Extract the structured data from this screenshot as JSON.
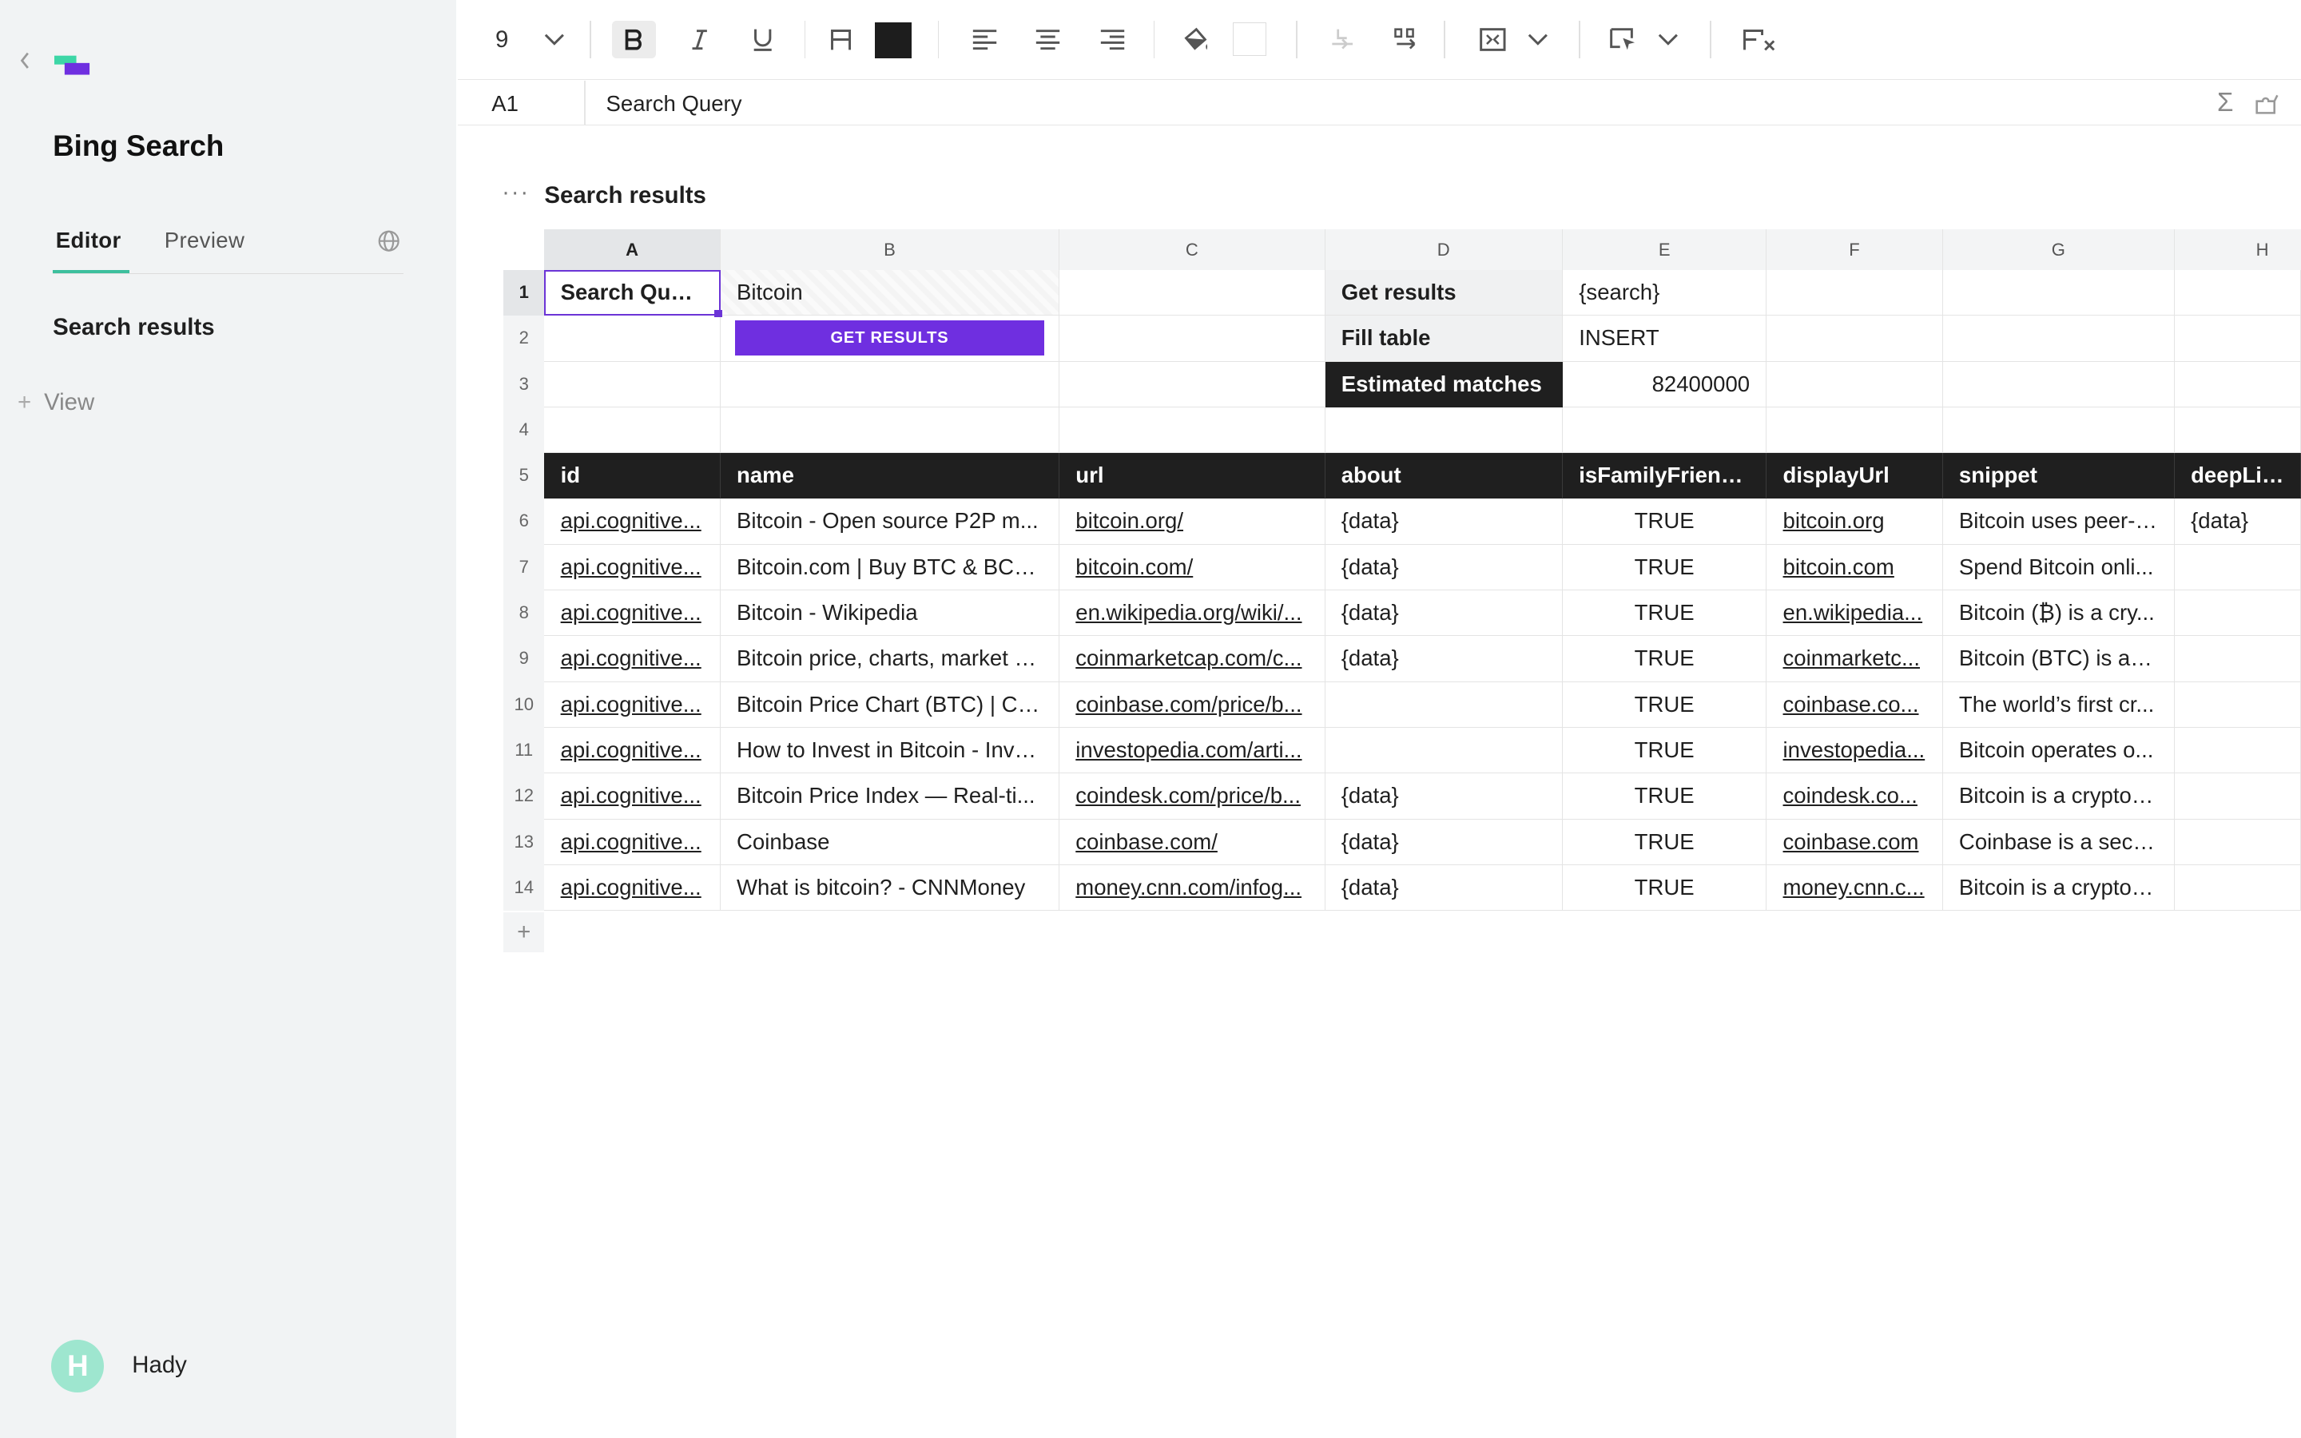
{
  "sidebar": {
    "app_title": "Bing Search",
    "tabs": [
      "Editor",
      "Preview"
    ],
    "section": "Search results",
    "add_view_label": "View",
    "user": {
      "initial": "H",
      "name": "Hady"
    }
  },
  "toolbar": {
    "font_size": "9",
    "icons": [
      "chevron-down-icon",
      "bold-icon",
      "italic-icon",
      "underline-icon",
      "text-format-icon",
      "text-color-swatch",
      "align-left-icon",
      "align-center-icon",
      "align-right-icon",
      "fill-bucket-icon",
      "fill-color-swatch",
      "indent-decrease-icon",
      "indent-increase-icon",
      "merge-icon",
      "select-icon",
      "clear-format-icon"
    ],
    "text_color": "#1d1d1d"
  },
  "formula_bar": {
    "cell_ref": "A1",
    "value": "Search Query"
  },
  "sheet": {
    "title": "Search results",
    "columns": [
      "A",
      "B",
      "C",
      "D",
      "E",
      "F",
      "G",
      "H"
    ],
    "active_column": "A",
    "rows": [
      "1",
      "2",
      "3",
      "4",
      "5",
      "6",
      "7",
      "8",
      "9",
      "10",
      "11",
      "12",
      "13",
      "14"
    ],
    "active_row": "1",
    "control": {
      "search_label": "Search Query",
      "search_value": "Bitcoin",
      "button_label": "GET RESULTS",
      "get_results_label": "Get results",
      "get_results_value": "{search}",
      "fill_table_label": "Fill table",
      "fill_table_value": "INSERT",
      "estimated_label": "Estimated matches",
      "estimated_value": "82400000"
    },
    "headers": [
      "id",
      "name",
      "url",
      "about",
      "isFamilyFriend...",
      "displayUrl",
      "snippet",
      "deepLinks"
    ],
    "data": [
      [
        "api.cognitive...",
        "Bitcoin - Open source P2P m...",
        "bitcoin.org/",
        "{data}",
        "TRUE",
        "bitcoin.org",
        "Bitcoin uses peer-t...",
        "{data}"
      ],
      [
        "api.cognitive...",
        "Bitcoin.com | Buy BTC & BCH...",
        "bitcoin.com/",
        "{data}",
        "TRUE",
        "bitcoin.com",
        "Spend Bitcoin onli...",
        ""
      ],
      [
        "api.cognitive...",
        "Bitcoin - Wikipedia",
        "en.wikipedia.org/wiki/...",
        "{data}",
        "TRUE",
        "en.wikipedia...",
        "Bitcoin (₿) is a cry...",
        ""
      ],
      [
        "api.cognitive...",
        "Bitcoin price, charts, market c...",
        "coinmarketcap.com/c...",
        "{data}",
        "TRUE",
        "coinmarketc...",
        "Bitcoin (BTC) is a c...",
        ""
      ],
      [
        "api.cognitive...",
        "Bitcoin Price Chart (BTC) | Co...",
        "coinbase.com/price/b...",
        "",
        "TRUE",
        "coinbase.co...",
        "The world’s first cr...",
        ""
      ],
      [
        "api.cognitive...",
        "How to Invest in Bitcoin - Inve...",
        "investopedia.com/arti...",
        "",
        "TRUE",
        "investopedia...",
        "Bitcoin operates o...",
        ""
      ],
      [
        "api.cognitive...",
        "Bitcoin Price Index — Real-ti...",
        "coindesk.com/price/b...",
        "{data}",
        "TRUE",
        "coindesk.co...",
        "Bitcoin is a cryptoc...",
        ""
      ],
      [
        "api.cognitive...",
        "Coinbase",
        "coinbase.com/",
        "{data}",
        "TRUE",
        "coinbase.com",
        "Coinbase is a secu...",
        ""
      ],
      [
        "api.cognitive...",
        "What is bitcoin? - CNNMoney",
        "money.cnn.com/infog...",
        "{data}",
        "TRUE",
        "money.cnn.c...",
        "Bitcoin is a cryptoc...",
        ""
      ]
    ]
  },
  "colors": {
    "accent": "#6f2fe0",
    "brand_green": "#3dbf9d",
    "header_dark": "#1f1f1f"
  }
}
